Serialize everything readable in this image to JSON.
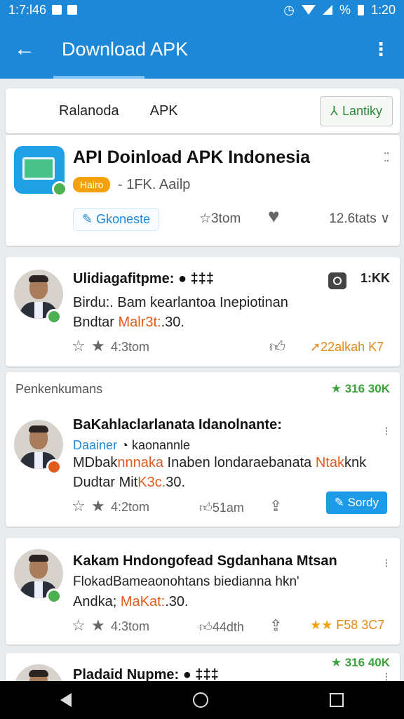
{
  "status_bar": {
    "time_left": "1:7:l46",
    "time_right": "1:20",
    "percent": "%"
  },
  "app_bar": {
    "title": "Download APK"
  },
  "tabs": {
    "tab1": "Ralanoda",
    "tab2": "APK",
    "button": "Lantiky"
  },
  "app": {
    "title": "API Doinload APK Indonesia",
    "badge": "Hairo",
    "subtitle": "- 1FK. Aailp",
    "chip": "Gkonestе",
    "stars": "3tom",
    "stats": "12.6tats"
  },
  "posts": [
    {
      "name": "Ulidiagafitpme: ● ‡‡‡",
      "line1": "Birdu:. Bam kearlantoa Inepiotinan",
      "line2_pre": "Bndtar",
      "line2_accent": "Malr3t:",
      "line2_post": ".30.",
      "count": "1:KK",
      "meta_left": "4:3tom",
      "meta_right": "22alkah K7"
    },
    {
      "section_label": "Penkenkumans",
      "section_right": "316 30K",
      "name": "BaKahlaclarlanata Idanolnante:",
      "link": "Daainer",
      "handle": "kaonannle",
      "line1_pre": "MDbak",
      "line1_accent": "nnnaka",
      "line1_mid": "Inaben londaraebanata",
      "line1_accent2": "Ntak",
      "line1_post": "knk",
      "line2_pre": "Dudtar Mit",
      "line2_accent": "K3c.",
      "line2_post": "30.",
      "meta_left": "4:2tom",
      "meta_mid": "51am",
      "button": "Sordy"
    },
    {
      "name": "Kakam Hndongofead Sgdanhana Mtsan",
      "line1": "FlokadBameaonohtans biedianna hkn'",
      "line2_pre": "Andka;",
      "line2_accent": "MaKat:",
      "line2_post": ".30.",
      "meta_left": "4:3tom",
      "meta_mid": "44dth",
      "meta_right": "F58 3C7"
    },
    {
      "name": "Pladaid Nupme: ● ‡‡‡",
      "section_right": "316 40K"
    }
  ]
}
